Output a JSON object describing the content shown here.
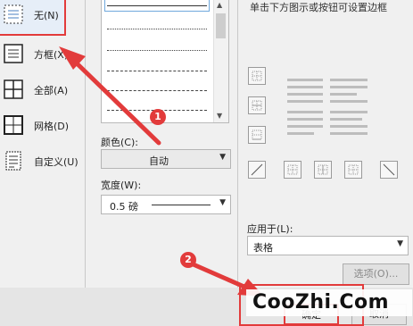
{
  "settings": {
    "items": [
      {
        "label": "无(N)",
        "icon": "border-none-icon"
      },
      {
        "label": "方框(X)",
        "icon": "border-box-icon"
      },
      {
        "label": "全部(A)",
        "icon": "border-all-icon"
      },
      {
        "label": "网格(D)",
        "icon": "border-grid-icon"
      },
      {
        "label": "自定义(U)",
        "icon": "border-custom-icon"
      }
    ]
  },
  "style": {
    "color_label": "颜色(C):",
    "color_value": "自动",
    "width_label": "宽度(W):",
    "width_value": "0.5  磅"
  },
  "preview": {
    "hint": "单击下方图示或按钮可设置边框",
    "apply_label": "应用于(L):",
    "apply_value": "表格",
    "options_button": "选项(O)..."
  },
  "footer": {
    "ok_button": "确定",
    "cancel_button": "取消"
  },
  "annotations": {
    "step1": "1",
    "step2": "2",
    "highlight_color": "#e23b3b"
  },
  "watermark": "CooZhi.Com"
}
